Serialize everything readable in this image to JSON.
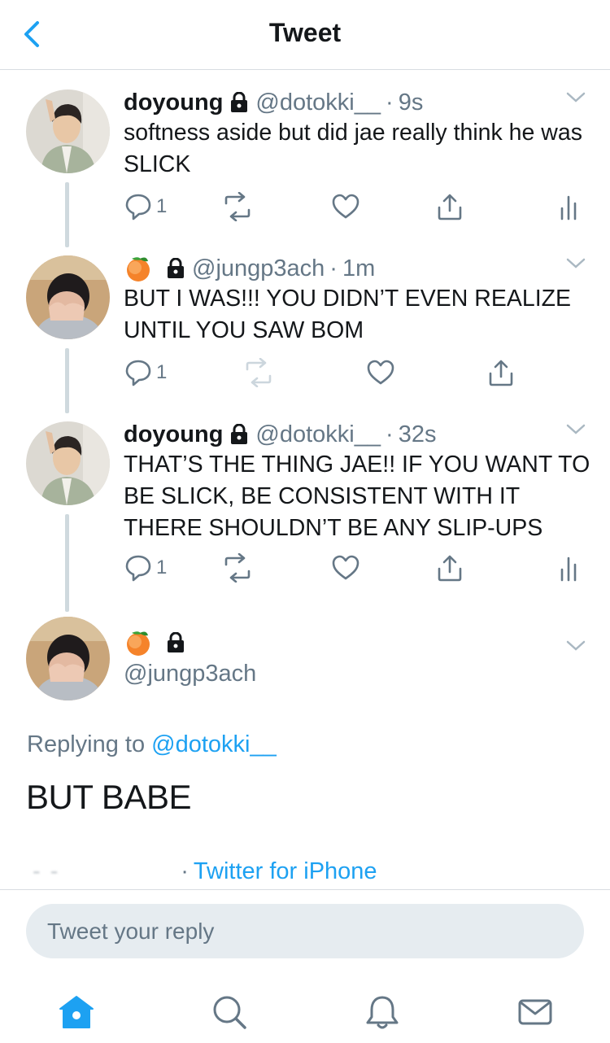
{
  "header": {
    "title": "Tweet"
  },
  "colors": {
    "accent": "#1da1f2",
    "muted": "#657786",
    "thread": "#cfd9de",
    "reply_box": "#e6ecf0"
  },
  "tweets": [
    {
      "name": "doyoung",
      "handle": "@dotokki__",
      "time": "9s",
      "text": "softness aside but did jae really think he was SLICK",
      "reply_count": "1",
      "has_analytics": true
    },
    {
      "name": "",
      "handle": "@jungp3ach",
      "time": "1m",
      "text": "BUT I WAS!!! YOU DIDN’T EVEN REALIZE UNTIL YOU SAW BOM",
      "reply_count": "1",
      "has_analytics": false
    },
    {
      "name": "doyoung",
      "handle": "@dotokki__",
      "time": "32s",
      "text": "THAT’S THE THING JAE!! IF YOU WANT TO BE SLICK, BE CONSISTENT WITH IT THERE SHOULDN’T BE ANY SLIP-UPS",
      "reply_count": "1",
      "has_analytics": true
    }
  ],
  "main_tweet": {
    "handle": "@jungp3ach",
    "replying_prefix": "Replying to",
    "replying_to": "@dotokki__",
    "text": "BUT BABE",
    "source_separator": "·",
    "source": "Twitter for iPhone"
  },
  "reply_box": {
    "placeholder": "Tweet your reply"
  },
  "icons": [
    "back-icon",
    "lock-icon",
    "peach-emoji-icon",
    "chevron-down-icon",
    "reply-icon",
    "retweet-icon",
    "like-icon",
    "share-icon",
    "analytics-icon",
    "home-icon",
    "search-icon",
    "notifications-icon",
    "messages-icon"
  ]
}
